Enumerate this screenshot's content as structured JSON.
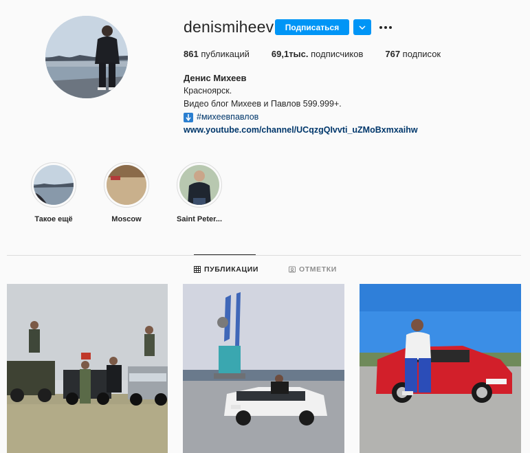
{
  "profile": {
    "username": "denismiheev",
    "follow_label": "Подписаться",
    "stats": {
      "posts_count": "861",
      "posts_label": " публикаций",
      "followers_count": "69,1тыс.",
      "followers_label": " подписчиков",
      "following_count": "767",
      "following_label": " подписок"
    },
    "bio": {
      "full_name": "Денис Михеев",
      "line1": "Красноярск.",
      "line2": "Видео блог Михеев и Павлов 599.999+.",
      "hashtag": "#михеевпавлов",
      "link": "www.youtube.com/channel/UCqzgQIvvti_uZMoBxmxaihw"
    }
  },
  "highlights": [
    {
      "label": "Такое ещё"
    },
    {
      "label": "Moscow"
    },
    {
      "label": "Saint Peter..."
    }
  ],
  "tabs": {
    "posts_label": "ПУБЛИКАЦИИ",
    "tagged_label": "ОТМЕТКИ"
  },
  "colors": {
    "accent": "#0095f6",
    "link": "#00376b",
    "background": "#fafafa",
    "divider": "#dbdbdb"
  },
  "icons": {
    "dropdown": "chevron-down-icon",
    "more": "more-dots-icon",
    "posts_tab": "grid-icon",
    "tagged_tab": "tag-portrait-icon",
    "hashtag_prefix": "down-arrow-emoji-icon"
  }
}
